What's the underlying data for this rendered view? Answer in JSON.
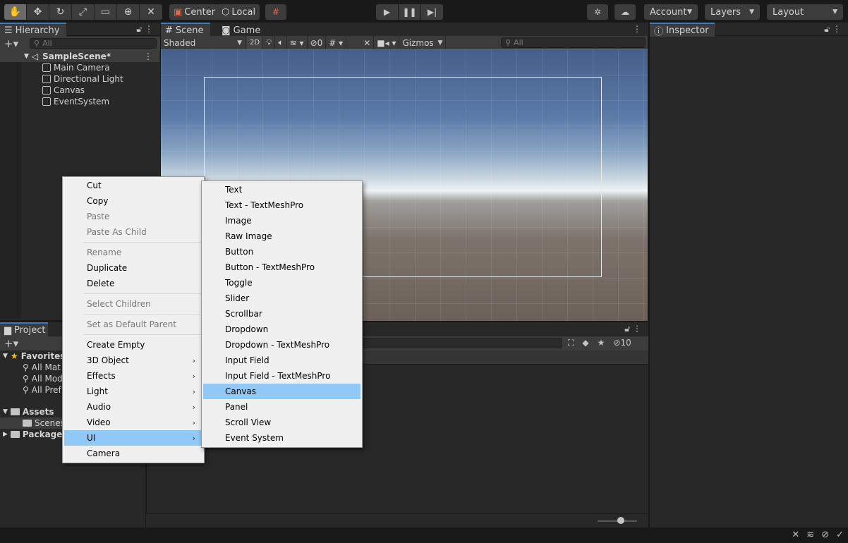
{
  "toolbar": {
    "pivot_label": "Center",
    "space_label": "Local",
    "account_label": "Account",
    "layers_label": "Layers",
    "layout_label": "Layout"
  },
  "hierarchy": {
    "tab_label": "Hierarchy",
    "search_placeholder": "All",
    "scene_name": "SampleScene*",
    "items": [
      "Main Camera",
      "Directional Light",
      "Canvas",
      "EventSystem"
    ]
  },
  "scene_view": {
    "tabs": [
      "Scene",
      "Game"
    ],
    "shading_mode": "Shaded",
    "mode_2d": "2D",
    "hidden_count": "0",
    "gizmos_label": "Gizmos",
    "search_placeholder": "All"
  },
  "project": {
    "tab_label": "Project",
    "hidden_count": "10",
    "favorites_label": "Favorites",
    "favorites": [
      "All Mat",
      "All Mod",
      "All Pref"
    ],
    "assets_label": "Assets",
    "assets_children": [
      "Scenes"
    ],
    "packages_label": "Packages"
  },
  "inspector": {
    "tab_label": "Inspector"
  },
  "context_menu": {
    "items": [
      {
        "label": "Cut",
        "enabled": true
      },
      {
        "label": "Copy",
        "enabled": true
      },
      {
        "label": "Paste",
        "enabled": false
      },
      {
        "label": "Paste As Child",
        "enabled": false
      },
      {
        "label": "Rename",
        "enabled": false
      },
      {
        "label": "Duplicate",
        "enabled": true
      },
      {
        "label": "Delete",
        "enabled": true
      },
      {
        "label": "Select Children",
        "enabled": false
      },
      {
        "label": "Set as Default Parent",
        "enabled": false
      },
      {
        "label": "Create Empty",
        "enabled": true
      },
      {
        "label": "3D Object",
        "enabled": true,
        "submenu": true
      },
      {
        "label": "Effects",
        "enabled": true,
        "submenu": true
      },
      {
        "label": "Light",
        "enabled": true,
        "submenu": true
      },
      {
        "label": "Audio",
        "enabled": true,
        "submenu": true
      },
      {
        "label": "Video",
        "enabled": true,
        "submenu": true
      },
      {
        "label": "UI",
        "enabled": true,
        "submenu": true,
        "highlighted": true
      },
      {
        "label": "Camera",
        "enabled": true
      }
    ]
  },
  "ui_submenu": {
    "items": [
      "Text",
      "Text - TextMeshPro",
      "Image",
      "Raw Image",
      "Button",
      "Button - TextMeshPro",
      "Toggle",
      "Slider",
      "Scrollbar",
      "Dropdown",
      "Dropdown - TextMeshPro",
      "Input Field",
      "Input Field - TextMeshPro",
      "Canvas",
      "Panel",
      "Scroll View",
      "Event System"
    ],
    "highlighted": "Canvas"
  },
  "colors": {
    "highlight": "#90c8f6",
    "panel_bg": "#282828",
    "tab_accent": "#3a79bb"
  }
}
